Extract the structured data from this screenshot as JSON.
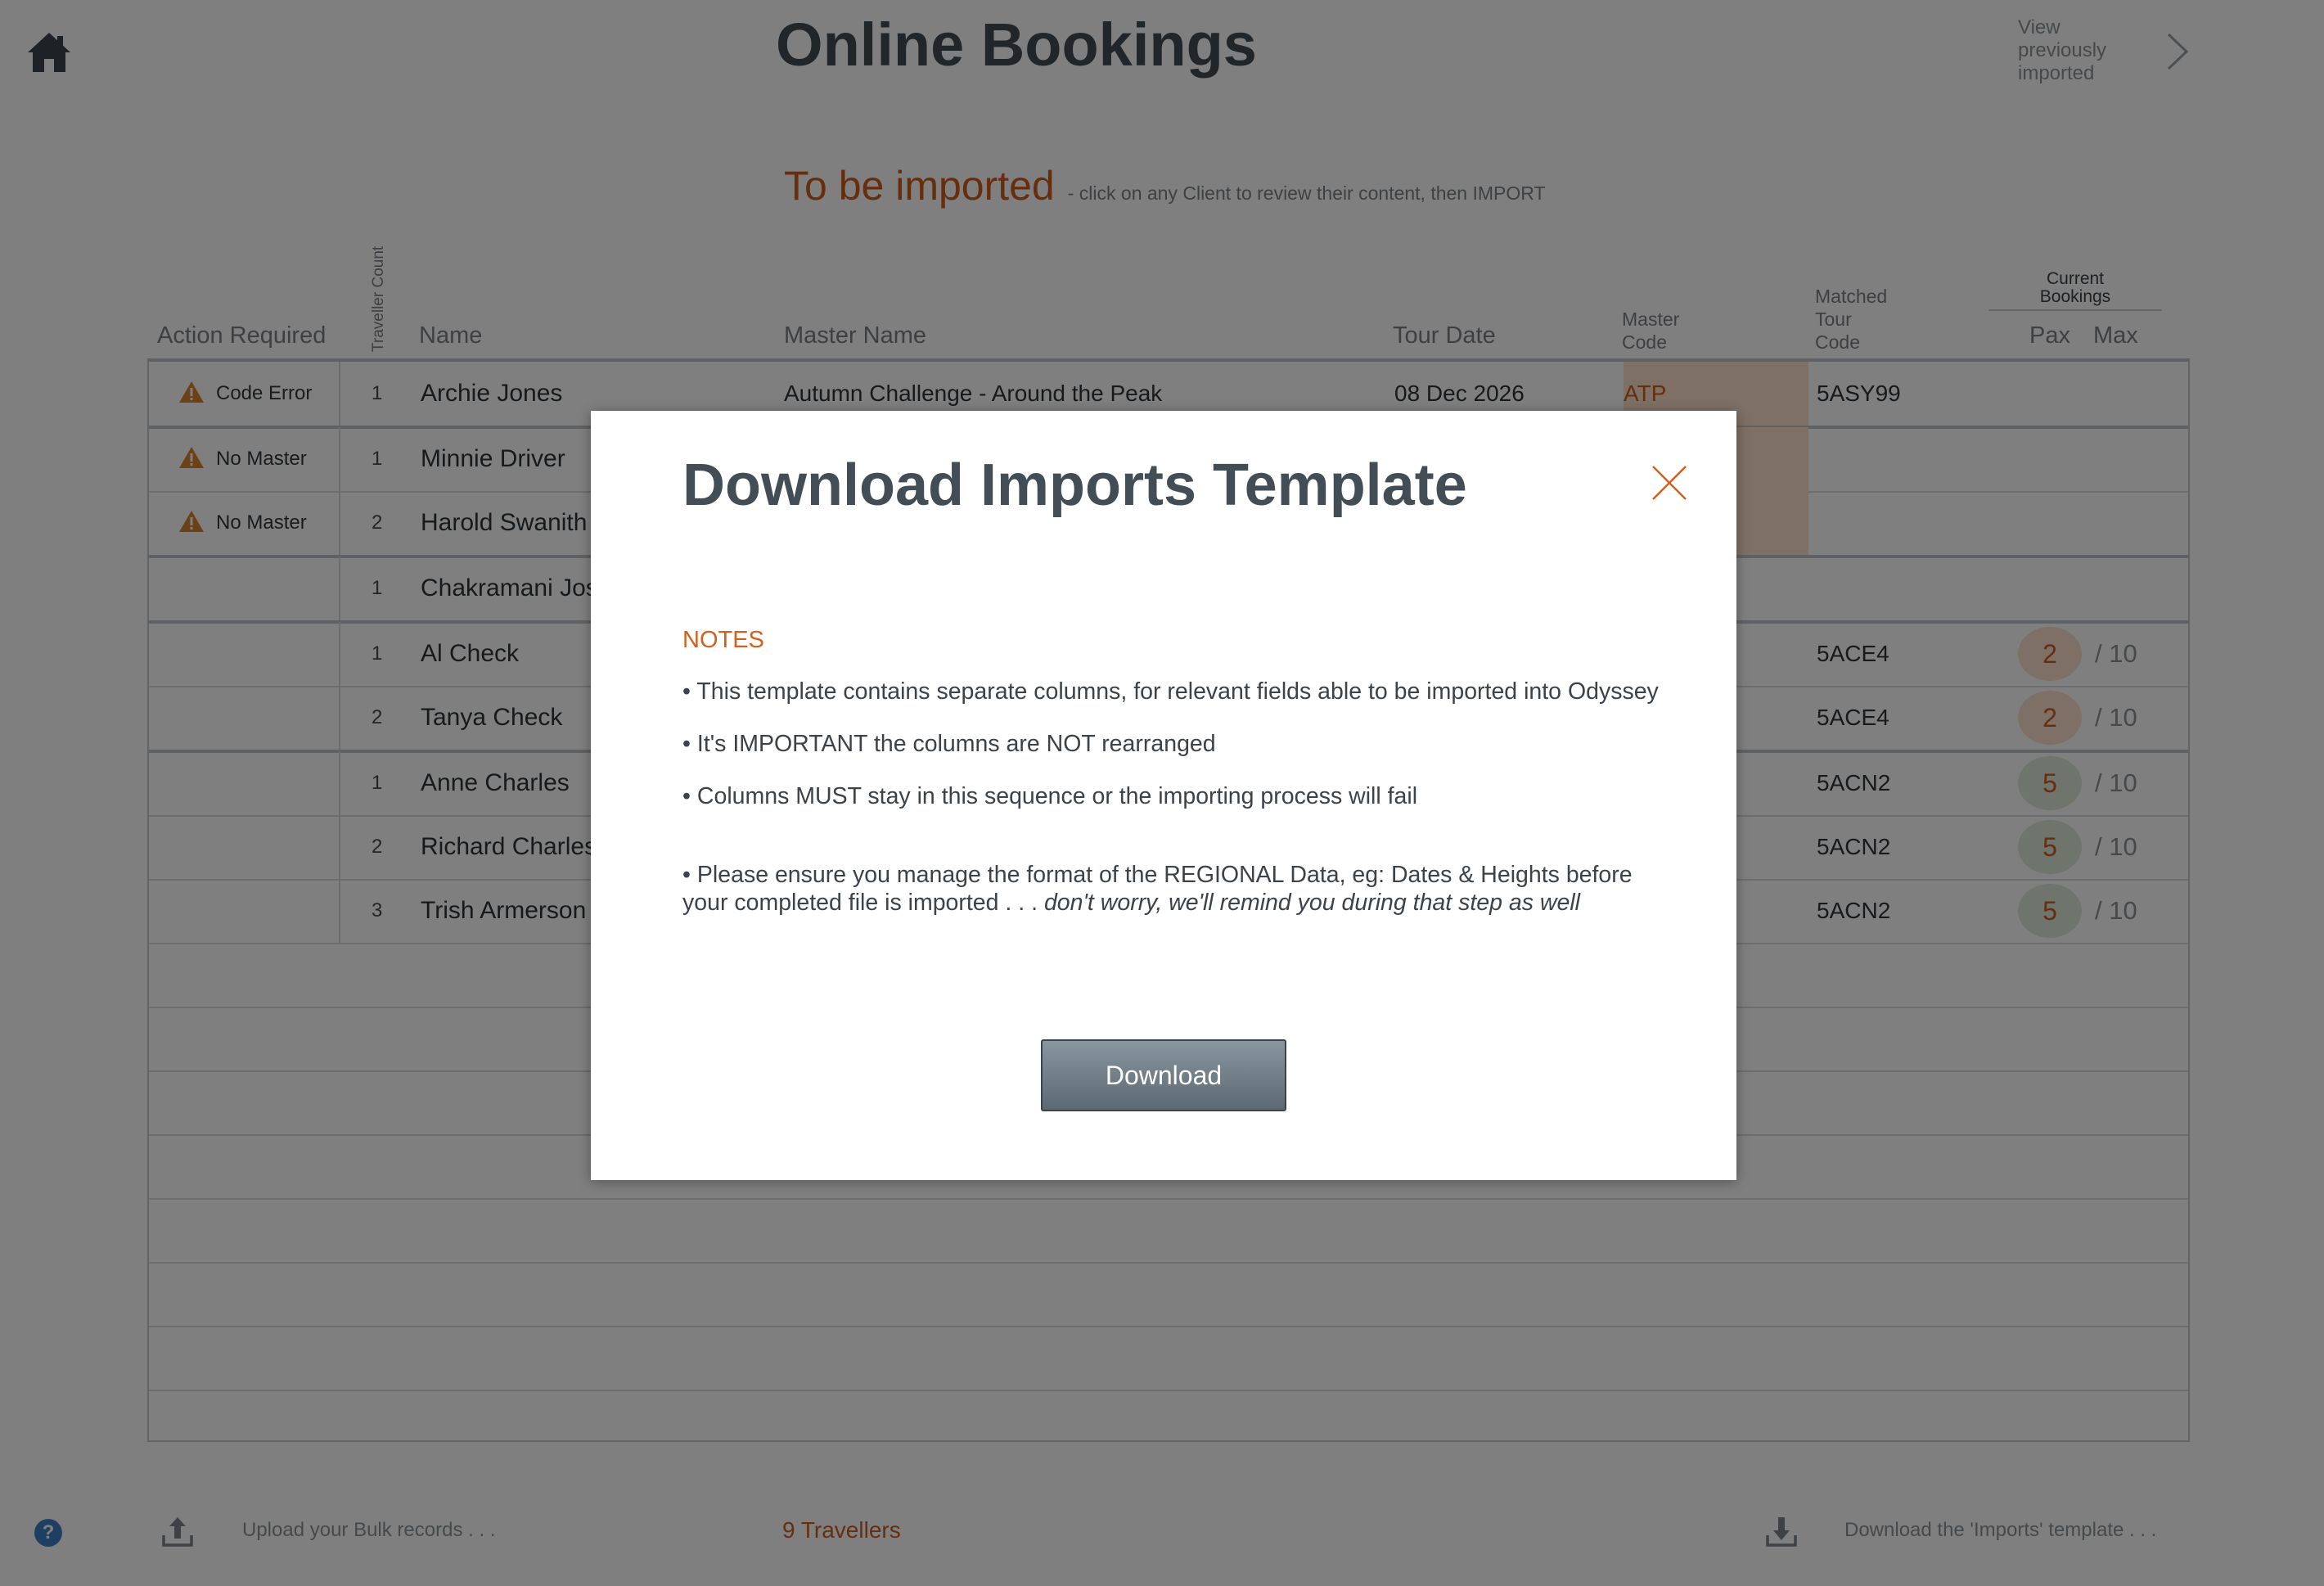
{
  "header": {
    "title": "Online Bookings",
    "view_previous": "View previously imported",
    "home_icon": "home-icon",
    "chevron_icon": "chevron-right-icon"
  },
  "section": {
    "title": "To be imported",
    "hint": "- click on any Client to review their content, then IMPORT"
  },
  "columns": {
    "action": "Action Required",
    "traveller_count": "Traveller Count",
    "name": "Name",
    "master_name": "Master Name",
    "tour_date": "Tour Date",
    "master_code_1": "Master",
    "master_code_2": "Code",
    "matched_1": "Matched",
    "matched_2": "Tour",
    "matched_3": "Code",
    "current_1": "Current",
    "current_2": "Bookings",
    "pax": "Pax",
    "max": "Max"
  },
  "rows": [
    {
      "action": "Code Error",
      "count": "1",
      "name": "Archie Jones",
      "master_name": "Autumn Challenge - Around the Peak",
      "tour_date": "08 Dec 2026",
      "master_code": "ATP",
      "tour_code": "5ASY99",
      "pax": "",
      "max": ""
    },
    {
      "action": "No Master",
      "count": "1",
      "name": "Minnie Driver",
      "master_name": "",
      "tour_date": "",
      "master_code": "",
      "tour_code": "",
      "pax": "",
      "max": ""
    },
    {
      "action": "No Master",
      "count": "2",
      "name": "Harold Swanith",
      "master_name": "",
      "tour_date": "",
      "master_code": "",
      "tour_code": "",
      "pax": "",
      "max": ""
    },
    {
      "action": "",
      "count": "1",
      "name": "Chakramani Joshi",
      "master_name": "",
      "tour_date": "",
      "master_code": "",
      "tour_code": "",
      "pax": "",
      "max": ""
    },
    {
      "action": "",
      "count": "1",
      "name": "Al Check",
      "master_name": "",
      "tour_date": "",
      "master_code": "",
      "tour_code": "5ACE4",
      "pax": "2",
      "max": "/ 10"
    },
    {
      "action": "",
      "count": "2",
      "name": "Tanya Check",
      "master_name": "",
      "tour_date": "",
      "master_code": "",
      "tour_code": "5ACE4",
      "pax": "2",
      "max": "/ 10"
    },
    {
      "action": "",
      "count": "1",
      "name": "Anne Charles",
      "master_name": "",
      "tour_date": "",
      "master_code": "",
      "tour_code": "5ACN2",
      "pax": "5",
      "max": "/ 10"
    },
    {
      "action": "",
      "count": "2",
      "name": "Richard Charles",
      "master_name": "",
      "tour_date": "",
      "master_code": "",
      "tour_code": "5ACN2",
      "pax": "5",
      "max": "/ 10"
    },
    {
      "action": "",
      "count": "3",
      "name": "Trish Armerson",
      "master_name": "",
      "tour_date": "",
      "master_code": "",
      "tour_code": "5ACN2",
      "pax": "5",
      "max": "/ 10"
    }
  ],
  "footer": {
    "help": "?",
    "upload_text": "Upload your Bulk records  . . .",
    "travellers": "9 Travellers",
    "download_text": "Download the 'Imports' template . . ."
  },
  "modal": {
    "title": "Download Imports Template",
    "notes_label": "NOTES",
    "line1": "• This template contains separate columns, for relevant fields able to be imported into Odyssey",
    "line2": "• It's IMPORTANT the columns are NOT rearranged",
    "line3": "• Columns MUST stay in this sequence or the importing process will fail",
    "line4a": "• Please ensure you manage the format of the REGIONAL Data, eg: Dates & Heights before your completed file is imported . . . ",
    "line4b": "don't worry, we'll remind you during that step as well",
    "button": "Download"
  },
  "colors": {
    "accent": "#cf5c1c",
    "title": "#434d55",
    "master_code_bg": "#fde1cb",
    "pax_low_bg": "#fde0cc",
    "pax_mid_bg": "#dfe8db",
    "warning": "#d8822c"
  }
}
